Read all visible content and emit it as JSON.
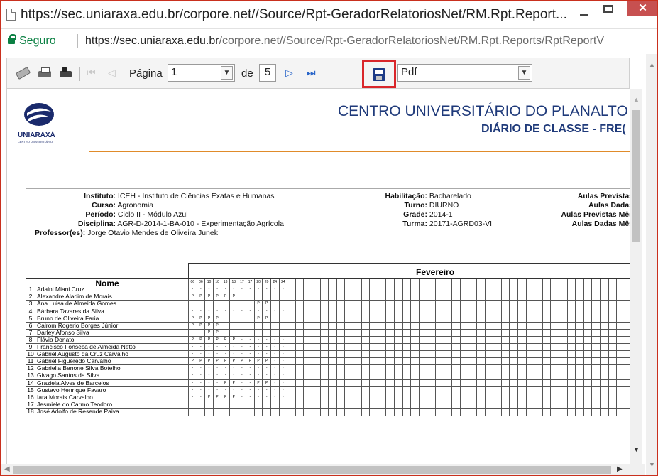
{
  "window": {
    "title": "https://sec.uniaraxa.edu.br/corpore.net//Source/Rpt-GeradorRelatoriosNet/RM.Rpt.Report...",
    "close_label": "✕"
  },
  "address": {
    "secure_label": "Seguro",
    "url_host": "https://sec.uniaraxa.edu.br",
    "url_path": "/corpore.net//Source/Rpt-GeradorRelatoriosNet/RM.Rpt.Reports/RptReportV"
  },
  "toolbar": {
    "page_label": "Página",
    "current_page": "1",
    "of_label": "de",
    "total_pages": "5",
    "export_format": "Pdf"
  },
  "report": {
    "logo_text": "UNIARAXÁ",
    "logo_subtext": "CENTRO UNIVERSITÁRIO",
    "institution": "CENTRO UNIVERSITÁRIO DO PLANALTO D",
    "document_title": "DIÁRIO DE CLASSE - FRE(",
    "info_left": [
      {
        "label": "Instituto:",
        "value": "ICEH - Instituto de Ciências Exatas e Humanas"
      },
      {
        "label": "Curso:",
        "value": "Agronomia"
      },
      {
        "label": "Período:",
        "value": "Ciclo II - Módulo Azul"
      },
      {
        "label": "Disciplina:",
        "value": "AGR-D-2014-1-BA-010 - Experimentação Agrícola"
      }
    ],
    "professor_label": "Professor(es):",
    "professor_value": "Jorge Otavio Mendes de Oliveira Junek",
    "info_mid": [
      {
        "label": "Habilitação:",
        "value": "Bacharelado"
      },
      {
        "label": "Turno:",
        "value": "DIURNO"
      },
      {
        "label": "Grade:",
        "value": "2014-1"
      },
      {
        "label": "Turma:",
        "value": "20171-AGRD03-VI"
      }
    ],
    "info_right": [
      {
        "label": "Aulas Previstas"
      },
      {
        "label": "Aulas Dadas"
      },
      {
        "label": "Aulas Previstas Mês"
      },
      {
        "label": "Aulas Dadas Mês"
      }
    ]
  },
  "attendance": {
    "month": "Fevereiro",
    "name_header": "Nome",
    "dates": [
      "06",
      "06",
      "10",
      "10",
      "13",
      "13",
      "17",
      "17",
      "20",
      "20",
      "24",
      "24"
    ],
    "students": [
      {
        "n": "1",
        "name": "Adalni Miani Cruz",
        "marks": "------------"
      },
      {
        "n": "2",
        "name": "Alexandre Aladim de Morais",
        "marks": "PPPPPP------"
      },
      {
        "n": "3",
        "name": "Ana Luisa de Almeida Gomes",
        "marks": "--------PP--"
      },
      {
        "n": "4",
        "name": "Bárbara Tavares da Silva",
        "marks": "------------"
      },
      {
        "n": "5",
        "name": "Bruno de Oliveira Faria",
        "marks": "PPPP----PP--"
      },
      {
        "n": "6",
        "name": "Calrom Rogerio Borges Júnior",
        "marks": "PPPP--------"
      },
      {
        "n": "7",
        "name": "Darley Afonso Silva",
        "marks": "--PP--------"
      },
      {
        "n": "8",
        "name": "Flávia Donato",
        "marks": "PPPPPP------"
      },
      {
        "n": "9",
        "name": "Francisco Fonseca de Almeida Netto",
        "marks": "------------"
      },
      {
        "n": "10",
        "name": "Gabriel Augusto da Cruz Carvalho",
        "marks": "------------"
      },
      {
        "n": "11",
        "name": "Gabriel Figueredo Carvalho",
        "marks": "PPPPPPPPPP--"
      },
      {
        "n": "12",
        "name": "Gabriella Benone Silva Botelho",
        "marks": "------------"
      },
      {
        "n": "13",
        "name": "Givago Santos da Silva",
        "marks": "------------"
      },
      {
        "n": "14",
        "name": "Graziela Alves de Barcelos",
        "marks": "----PP--PP--"
      },
      {
        "n": "15",
        "name": "Gustavo Henrique Favaro",
        "marks": "------------"
      },
      {
        "n": "16",
        "name": "Iara Morais Carvalho",
        "marks": "--PPPP------"
      },
      {
        "n": "17",
        "name": "Jesmiele do Carmo Teodoro",
        "marks": "------------"
      },
      {
        "n": "18",
        "name": "José Adolfo de Resende Paiva",
        "marks": "------------"
      }
    ]
  }
}
